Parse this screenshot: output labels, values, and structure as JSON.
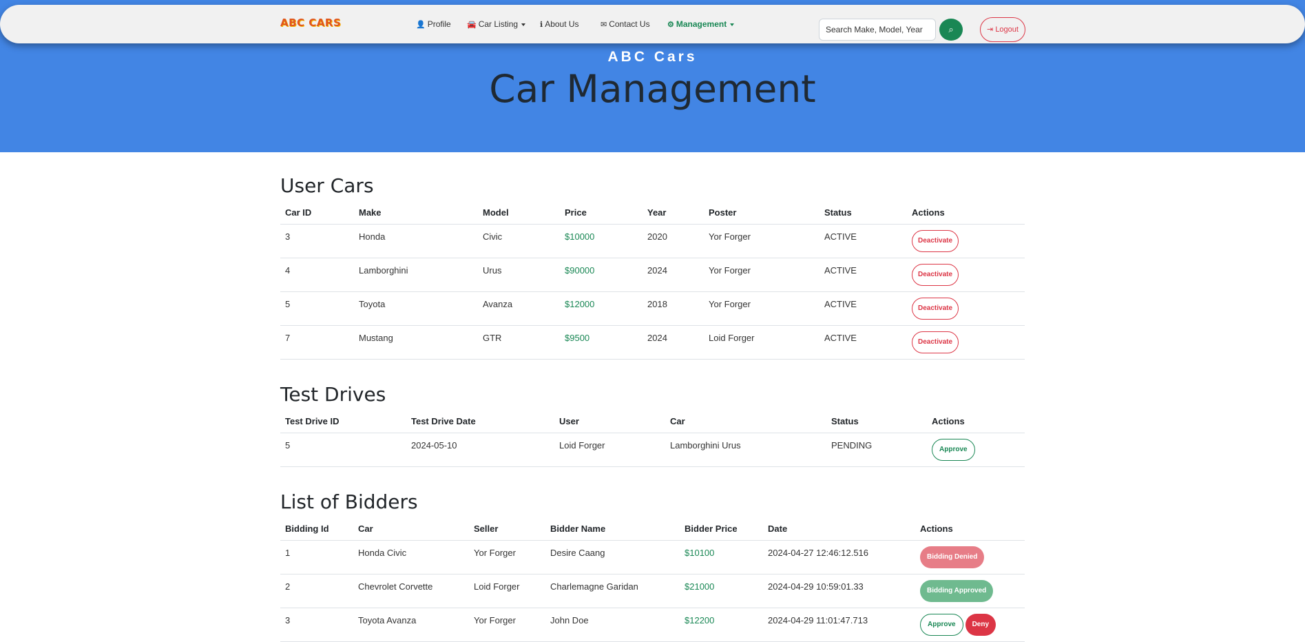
{
  "nav": {
    "brand": "ABC CARS",
    "items": [
      {
        "icon": "user-icon",
        "glyph": "👤",
        "label": "Profile"
      },
      {
        "icon": "car-icon",
        "glyph": "🚘",
        "label": "Car Listing"
      },
      {
        "icon": "info-icon",
        "glyph": "ℹ",
        "label": "About Us"
      },
      {
        "icon": "envelope-icon",
        "glyph": "✉",
        "label": "Contact Us"
      },
      {
        "icon": "gears-icon",
        "glyph": "⚙",
        "label": "Management"
      }
    ],
    "search_placeholder": "Search Make, Model, Year",
    "search_glyph": "⌕",
    "logout_label": "Logout",
    "logout_glyph": "⇥"
  },
  "hero": {
    "subtitle": "ABC Cars",
    "title": "Car Management"
  },
  "colors": {
    "hero": "#4285e4",
    "success": "#198754",
    "danger": "#dc3545"
  },
  "user_cars": {
    "title": "User Cars",
    "headers": [
      "Car ID",
      "Make",
      "Model",
      "Price",
      "Year",
      "Poster",
      "Status",
      "Actions"
    ],
    "rows": [
      {
        "id": "3",
        "make": "Honda",
        "model": "Civic",
        "price": "$10000",
        "year": "2020",
        "poster": "Yor Forger",
        "status": "ACTIVE",
        "action": "Deactivate"
      },
      {
        "id": "4",
        "make": "Lamborghini",
        "model": "Urus",
        "price": "$90000",
        "year": "2024",
        "poster": "Yor Forger",
        "status": "ACTIVE",
        "action": "Deactivate"
      },
      {
        "id": "5",
        "make": "Toyota",
        "model": "Avanza",
        "price": "$12000",
        "year": "2018",
        "poster": "Yor Forger",
        "status": "ACTIVE",
        "action": "Deactivate"
      },
      {
        "id": "7",
        "make": "Mustang",
        "model": "GTR",
        "price": "$9500",
        "year": "2024",
        "poster": "Loid Forger",
        "status": "ACTIVE",
        "action": "Deactivate"
      }
    ]
  },
  "test_drives": {
    "title": "Test Drives",
    "headers": [
      "Test Drive ID",
      "Test Drive Date",
      "User",
      "Car",
      "Status",
      "Actions"
    ],
    "rows": [
      {
        "id": "5",
        "date": "2024-05-10",
        "user": "Loid Forger",
        "car": "Lamborghini Urus",
        "status": "PENDING",
        "action": "Approve"
      }
    ]
  },
  "bidders": {
    "title": "List of Bidders",
    "headers": [
      "Bidding Id",
      "Car",
      "Seller",
      "Bidder Name",
      "Bidder Price",
      "Date",
      "Actions"
    ],
    "rows": [
      {
        "id": "1",
        "car": "Honda Civic",
        "seller": "Yor Forger",
        "bidder": "Desire Caang",
        "price": "$10100",
        "date": "2024-04-27 12:46:12.516",
        "actions": [
          "Bidding Denied"
        ]
      },
      {
        "id": "2",
        "car": "Chevrolet Corvette",
        "seller": "Loid Forger",
        "bidder": "Charlemagne Garidan",
        "price": "$21000",
        "date": "2024-04-29 10:59:01.33",
        "actions": [
          "Bidding Approved"
        ]
      },
      {
        "id": "3",
        "car": "Toyota Avanza",
        "seller": "Yor Forger",
        "bidder": "John Doe",
        "price": "$12200",
        "date": "2024-04-29 11:01:47.713",
        "actions": [
          "Approve",
          "Deny"
        ]
      }
    ]
  }
}
